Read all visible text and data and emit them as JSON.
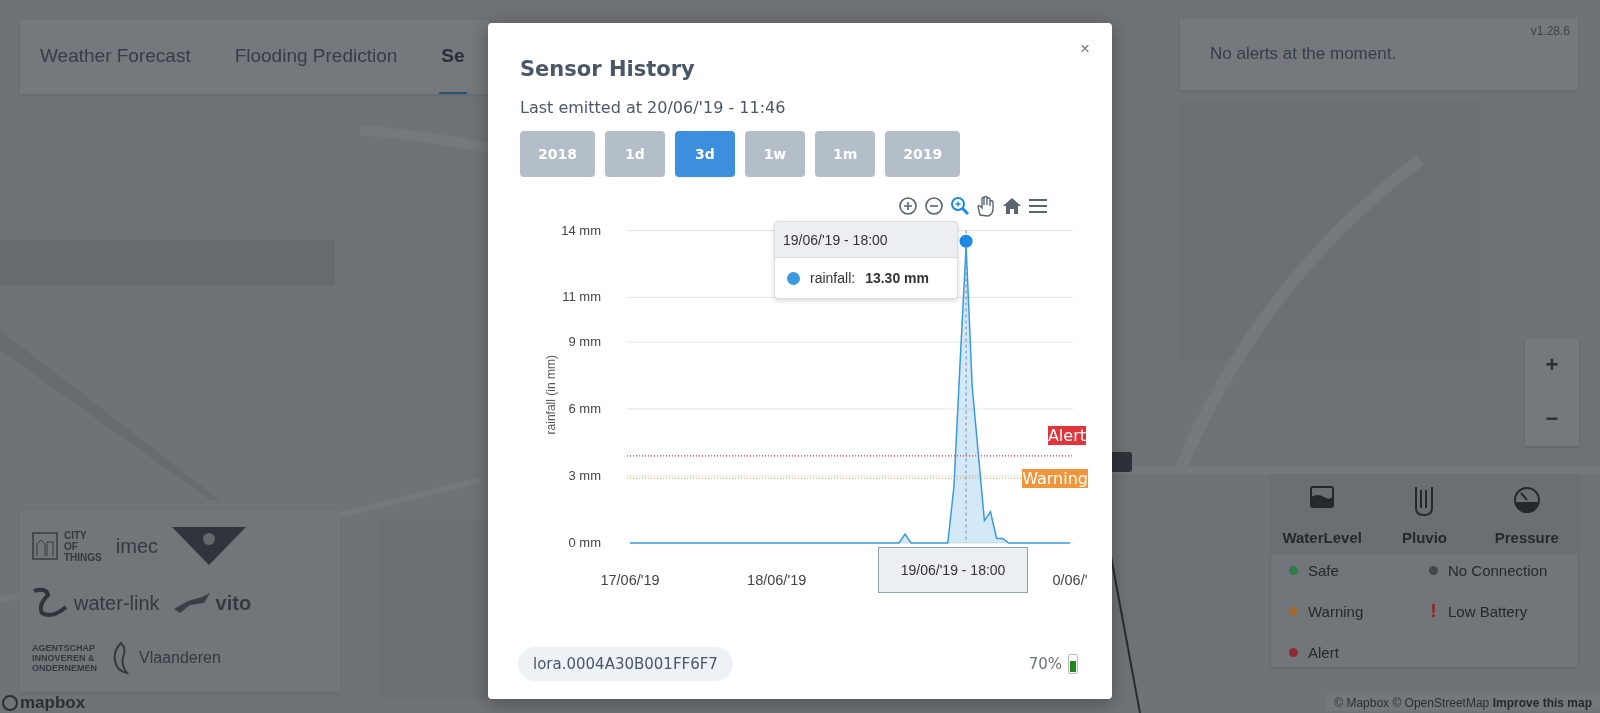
{
  "tabs": [
    {
      "label": "Weather Forecast",
      "selected": false
    },
    {
      "label": "Flooding Prediction",
      "selected": false
    },
    {
      "label": "Se",
      "selected": true
    }
  ],
  "alerts": {
    "message": "No alerts at the moment.",
    "version": "v1.28.6"
  },
  "zoom": {
    "zoom_in": "+",
    "zoom_out": "−"
  },
  "legend": {
    "sensor_types": [
      {
        "label": "WaterLevel",
        "kind": "waterlevel"
      },
      {
        "label": "Pluvio",
        "kind": "pluvio"
      },
      {
        "label": "Pressure",
        "kind": "pressure"
      }
    ],
    "statuses": [
      {
        "label": "Safe",
        "kind": "dot",
        "color": "#2e7d4a"
      },
      {
        "label": "No Connection",
        "kind": "dot",
        "color": "#44484c"
      },
      {
        "label": "Warning",
        "kind": "dot",
        "color": "#9c6a35"
      },
      {
        "label": "Low Battery",
        "kind": "mark",
        "mark": "!"
      },
      {
        "label": "Alert",
        "kind": "dot",
        "color": "#8e2a30"
      }
    ]
  },
  "partners": [
    {
      "kind": "cityofthings",
      "lines": [
        "CITY",
        "OF",
        "THINGS"
      ]
    },
    {
      "kind": "imec",
      "lines": [
        "imec"
      ]
    },
    {
      "kind": "shield"
    },
    {
      "kind": "waterlink",
      "lines": [
        "water-link"
      ]
    },
    {
      "kind": "vito",
      "lines": [
        "vito"
      ]
    },
    {
      "kind": "agentschap",
      "lines": [
        "AGENTSCHAP",
        "INNOVEREN &",
        "ONDERNEMEN"
      ]
    },
    {
      "kind": "vlaanderen",
      "lines": [
        "Vlaanderen"
      ]
    }
  ],
  "map": {
    "logo": "mapbox",
    "attribution": "© Mapbox © OpenStreetMap",
    "improve_link": "Improve this map"
  },
  "modal": {
    "title": "Sensor History",
    "subtitle": "Last emitted at 20/06/'19 - 11:46",
    "close": "×",
    "ranges": [
      {
        "label": "2018",
        "selected": false
      },
      {
        "label": "1d",
        "selected": false
      },
      {
        "label": "3d",
        "selected": true
      },
      {
        "label": "1w",
        "selected": false
      },
      {
        "label": "1m",
        "selected": false
      },
      {
        "label": "2019",
        "selected": false
      }
    ],
    "toolbar": [
      {
        "kind": "zoom-in",
        "selected": false
      },
      {
        "kind": "zoom-out",
        "selected": false
      },
      {
        "kind": "selection-zoom",
        "selected": true
      },
      {
        "kind": "pan",
        "selected": false
      },
      {
        "kind": "home",
        "selected": false
      },
      {
        "kind": "menu",
        "selected": false
      }
    ],
    "chart_data": {
      "type": "area",
      "ylabel": "rainfall (in mm)",
      "categories": [
        "17/06/'19",
        null,
        null,
        null,
        null,
        null,
        null,
        null,
        null,
        null,
        null,
        null,
        null,
        null,
        null,
        null,
        null,
        null,
        null,
        null,
        null,
        null,
        null,
        null,
        "18/06/'19",
        null,
        null,
        null,
        null,
        null,
        null,
        null,
        null,
        null,
        null,
        null,
        null,
        null,
        null,
        null,
        null,
        null,
        null,
        null,
        null,
        null,
        null,
        null,
        null,
        null,
        null,
        null,
        null,
        null,
        null,
        null,
        null,
        null,
        null,
        null,
        null,
        null,
        null,
        null,
        null,
        null,
        null,
        null,
        null,
        null,
        null,
        null,
        "0/06/'"
      ],
      "series": [
        {
          "name": "rainfall",
          "color": "#3a9ae0",
          "values": [
            0,
            0,
            0,
            0,
            0,
            0,
            0,
            0,
            0,
            0,
            0,
            0,
            0,
            0,
            0,
            0,
            0,
            0,
            0,
            0,
            0,
            0,
            0,
            0,
            0,
            0,
            0,
            0,
            0,
            0,
            0,
            0,
            0,
            0,
            0,
            0,
            0,
            0,
            0,
            0,
            0,
            0,
            0,
            0,
            0,
            0.4,
            0,
            0,
            0,
            0,
            0,
            0,
            0,
            2.5,
            8,
            13.3,
            7,
            4,
            1.0,
            1.4,
            0.2,
            0.2,
            0,
            0,
            0,
            0,
            0,
            0,
            0,
            0,
            0,
            0,
            0
          ]
        }
      ],
      "ylim": [
        0,
        14
      ],
      "grid": true,
      "yticks": [
        {
          "value": 0,
          "label": "0 mm"
        },
        {
          "value": 3,
          "label": "3 mm"
        },
        {
          "value": 6,
          "label": "6 mm"
        },
        {
          "value": 9,
          "label": "9 mm"
        },
        {
          "value": 11,
          "label": "11 mm"
        },
        {
          "value": 14,
          "label": "14 mm"
        }
      ],
      "ref_lines": [
        {
          "axis": "y",
          "value": 3.9,
          "label": "Alert",
          "color": "#e0353b"
        },
        {
          "axis": "y",
          "value": 2.9,
          "label": "Warning",
          "color": "#f0953b"
        }
      ]
    },
    "tooltip": {
      "title": "19/06/'19 - 18:00",
      "separator": ":",
      "value": "13.30 mm"
    },
    "crosshair_label": "19/06/'19 - 18:00",
    "device_id": "lora.0004A30B001FF6F7",
    "battery": {
      "reading": "70%",
      "level": 0.7
    }
  }
}
